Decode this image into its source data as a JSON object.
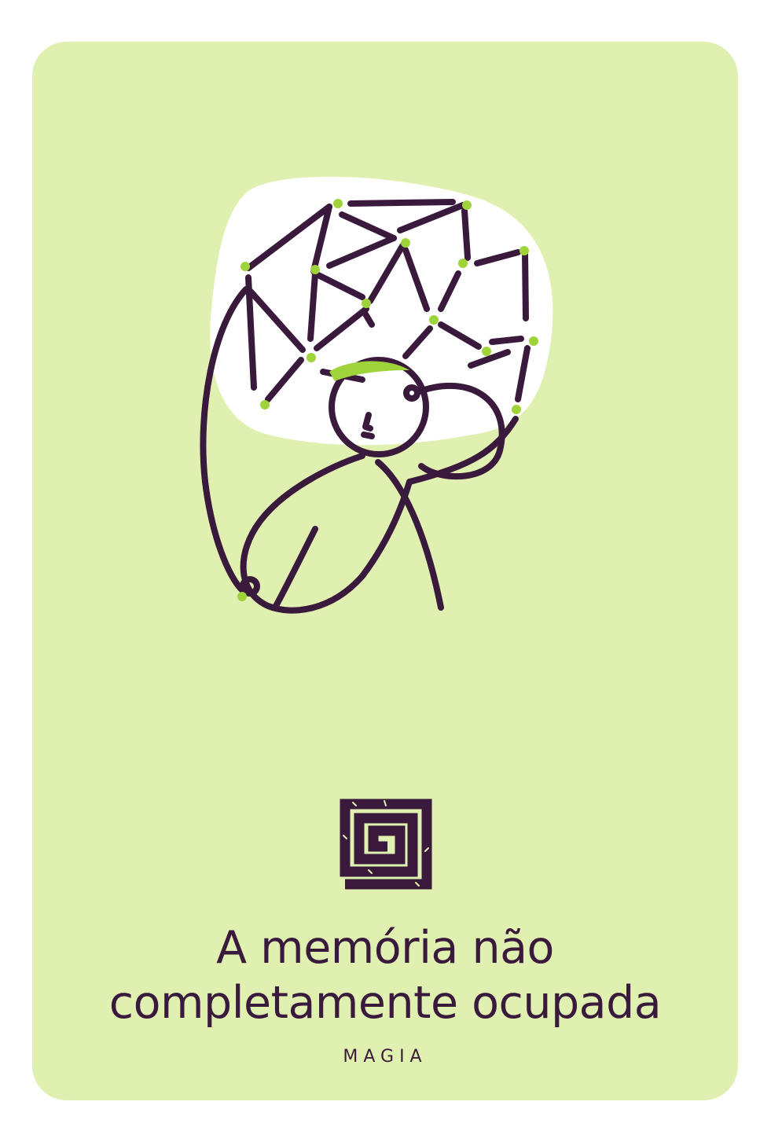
{
  "card": {
    "title_line1": "A memória não",
    "title_line2": "completamente ocupada",
    "category": "MAGIA"
  },
  "illustration": {
    "icon": "person-with-network-head-icon",
    "emblem_icon": "square-spiral-icon"
  },
  "colors": {
    "background": "#e0f0b0",
    "ink": "#3a1a3c",
    "accent": "#9fd33a",
    "bubble": "#ffffff"
  }
}
